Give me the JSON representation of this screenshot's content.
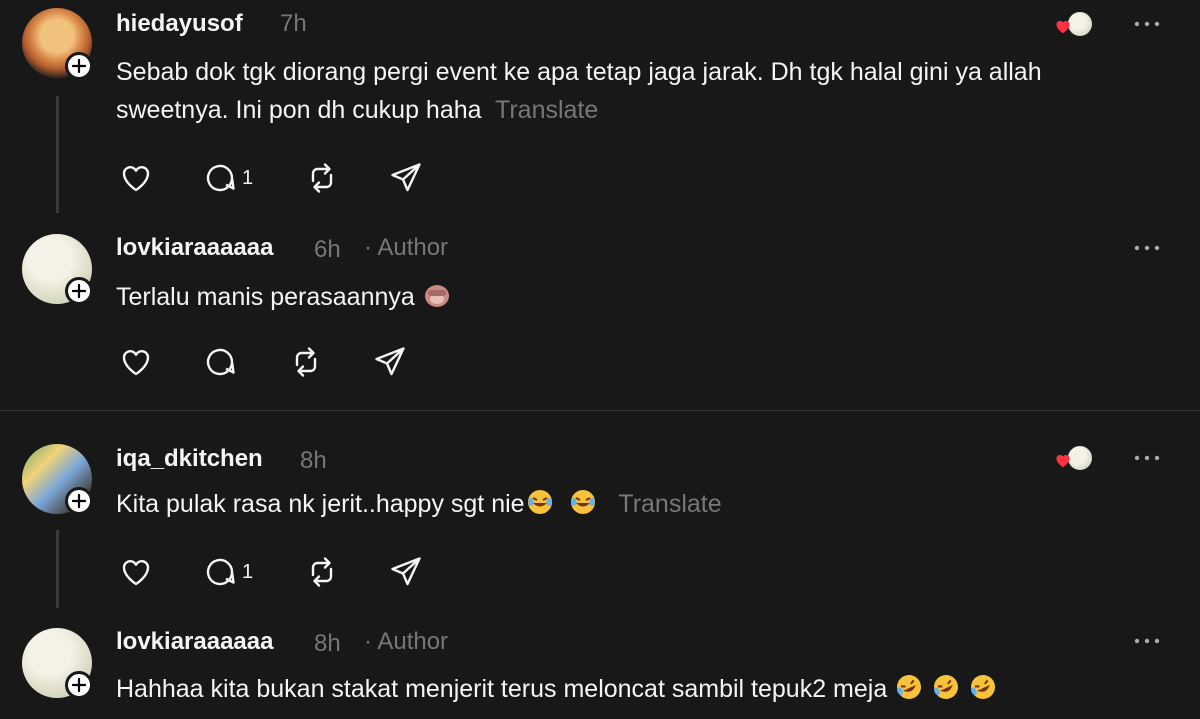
{
  "posts": [
    {
      "username": "hiedayusof",
      "time": "7h",
      "text": "Sebab dok tgk diorang pergi event ke apa tetap jaga jarak. Dh tgk halal gini ya allah sweetnya. Ini pon dh cukup haha",
      "translate_label": "Translate",
      "reply_count": "1"
    },
    {
      "username": "lovkiaraaaaaa",
      "time": "6h",
      "author_label": "· Author",
      "text": "Terlalu manis perasaannya"
    },
    {
      "username": "iqa_dkitchen",
      "time": "8h",
      "text": "Kita pulak rasa nk jerit..happy sgt nie",
      "translate_label": "Translate",
      "reply_count": "1"
    },
    {
      "username": "lovkiaraaaaaa",
      "time": "8h",
      "author_label": "· Author",
      "text": "Hahhaa kita bukan stakat menjerit terus meloncat sambil tepuk2 meja"
    }
  ],
  "colors": {
    "background": "#181818",
    "text": "#f3f5f7",
    "muted": "#777777",
    "heart": "#ff3040"
  },
  "icons": [
    "heart-icon",
    "comment-icon",
    "repost-icon",
    "share-icon",
    "more-icon",
    "follow-plus-icon"
  ]
}
